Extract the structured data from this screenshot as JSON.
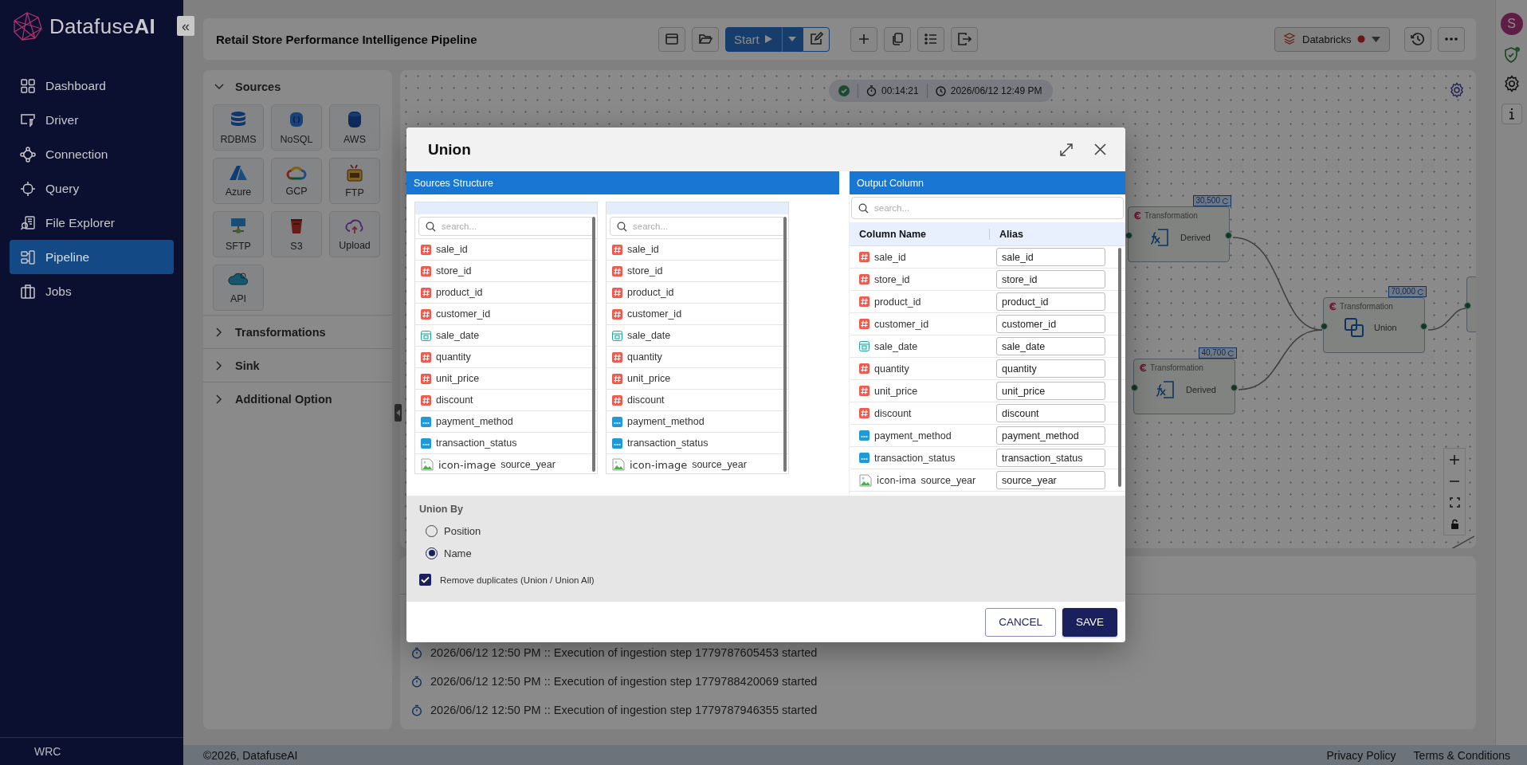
{
  "sidebar": {
    "logo": "Datafuse**AI**",
    "collapse": "«",
    "items": [
      {
        "label": "Dashboard",
        "selected": false
      },
      {
        "label": "Driver",
        "selected": false
      },
      {
        "label": "Connection",
        "selected": false
      },
      {
        "label": "Query",
        "selected": false
      },
      {
        "label": "File Explorer",
        "selected": false
      },
      {
        "label": "Pipeline",
        "selected": true
      },
      {
        "label": "Jobs",
        "selected": false
      }
    ],
    "footer": "WRC"
  },
  "header": {
    "title": "Retail Store Performance Intelligence Pipeline",
    "run_label": "Start",
    "engine": "Databricks"
  },
  "user": {
    "initial": "S"
  },
  "palette": {
    "sections": [
      {
        "title": "Sources",
        "expanded": true,
        "items": [
          "RDBMS",
          "NoSQL",
          "AWS",
          "Azure",
          "GCP",
          "FTP",
          "SFTP",
          "S3",
          "Upload",
          "API"
        ]
      },
      {
        "title": "Transformations",
        "expanded": false
      },
      {
        "title": "Sink",
        "expanded": false
      },
      {
        "title": "Additional Option",
        "expanded": false
      }
    ]
  },
  "canvas": {
    "status": {
      "elapsed": "00:14:21",
      "timestamp": "2026/06/12 12:49 PM"
    },
    "nodes": [
      {
        "kind": "derived",
        "category": "Transformation",
        "label": "Derived",
        "count": "30,500"
      },
      {
        "kind": "union",
        "category": "Transformation",
        "label": "Union",
        "count": "70,000"
      },
      {
        "kind": "derived",
        "category": "Transformation",
        "label": "Derived",
        "count": "40,700"
      }
    ]
  },
  "log": {
    "entries": [
      "2026/06/12 12:50 PM :: Execution of ingestion step 1779787605453 started",
      "2026/06/12 12:50 PM :: Execution of ingestion step 1779788420069 started",
      "2026/06/12 12:50 PM :: Execution of ingestion step 1779787946355 started"
    ]
  },
  "dialog": {
    "title": "Union",
    "sources_heading": "Sources Structure",
    "sources": [
      {
        "placeholder": "search...",
        "fields": [
          {
            "name": "sale_id",
            "kind": "number"
          },
          {
            "name": "store_id",
            "kind": "number"
          },
          {
            "name": "product_id",
            "kind": "number"
          },
          {
            "name": "customer_id",
            "kind": "number"
          },
          {
            "name": "sale_date",
            "kind": "date"
          },
          {
            "name": "quantity",
            "kind": "number"
          },
          {
            "name": "unit_price",
            "kind": "number"
          },
          {
            "name": "discount",
            "kind": "number"
          },
          {
            "name": "payment_method",
            "kind": "text"
          },
          {
            "name": "transaction_status",
            "kind": "text"
          },
          {
            "name": "source_year",
            "kind": "image",
            "alt": "icon-image"
          }
        ]
      },
      {
        "placeholder": "search...",
        "fields": [
          {
            "name": "sale_id",
            "kind": "number"
          },
          {
            "name": "store_id",
            "kind": "number"
          },
          {
            "name": "product_id",
            "kind": "number"
          },
          {
            "name": "customer_id",
            "kind": "number"
          },
          {
            "name": "sale_date",
            "kind": "date"
          },
          {
            "name": "quantity",
            "kind": "number"
          },
          {
            "name": "unit_price",
            "kind": "number"
          },
          {
            "name": "discount",
            "kind": "number"
          },
          {
            "name": "payment_method",
            "kind": "text"
          },
          {
            "name": "transaction_status",
            "kind": "text"
          },
          {
            "name": "source_year",
            "kind": "image",
            "alt": "icon-image"
          }
        ]
      }
    ],
    "output_heading": "Output Column",
    "output": {
      "placeholder": "search...",
      "columns": [
        "Column Name",
        "Alias"
      ],
      "rows": [
        {
          "name": "sale_id",
          "kind": "number",
          "alias": "sale_id"
        },
        {
          "name": "store_id",
          "kind": "number",
          "alias": "store_id"
        },
        {
          "name": "product_id",
          "kind": "number",
          "alias": "product_id"
        },
        {
          "name": "customer_id",
          "kind": "number",
          "alias": "customer_id"
        },
        {
          "name": "sale_date",
          "kind": "date",
          "alias": "sale_date"
        },
        {
          "name": "quantity",
          "kind": "number",
          "alias": "quantity"
        },
        {
          "name": "unit_price",
          "kind": "number",
          "alias": "unit_price"
        },
        {
          "name": "discount",
          "kind": "number",
          "alias": "discount"
        },
        {
          "name": "payment_method",
          "kind": "text",
          "alias": "payment_method"
        },
        {
          "name": "transaction_status",
          "kind": "text",
          "alias": "transaction_status"
        },
        {
          "name": "source_year",
          "kind": "image",
          "alt": "icon-ima",
          "alias": "source_year"
        }
      ]
    },
    "union_by": {
      "label": "Union By",
      "options": [
        {
          "label": "Position",
          "selected": false
        },
        {
          "label": "Name",
          "selected": true
        }
      ]
    },
    "remove_duplicates": {
      "label": "Remove duplicates (Union / Union All)",
      "checked": true
    },
    "buttons": [
      {
        "label": "CANCEL",
        "kind": "secondary"
      },
      {
        "label": "SAVE",
        "kind": "primary"
      }
    ]
  },
  "footer": {
    "copyright": "©2026, DatafuseAI",
    "links": [
      "Privacy Policy",
      "Terms & Conditions"
    ]
  }
}
